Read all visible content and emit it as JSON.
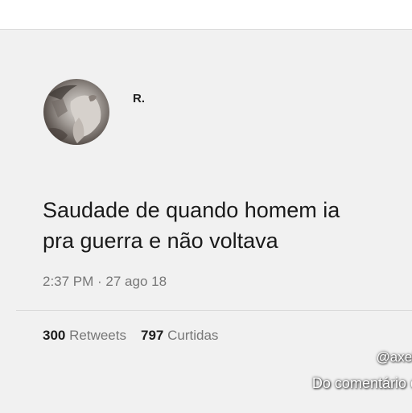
{
  "tweet": {
    "display_name": "R.",
    "text_line1": "Saudade de quando homem ia",
    "text_line2": "pra guerra e não voltava",
    "timestamp": "2:37 PM · 27 ago 18",
    "retweets_count": "300",
    "retweets_label": "Retweets",
    "likes_count": "797",
    "likes_label": "Curtidas"
  },
  "overlay": {
    "handle": "@axel",
    "caption": "Do comentário do"
  }
}
